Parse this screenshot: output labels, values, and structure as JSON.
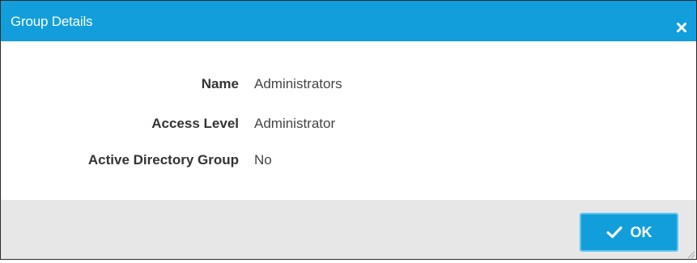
{
  "dialog": {
    "title": "Group Details",
    "close_icon": "close-icon"
  },
  "details": [
    {
      "label": "Name",
      "value": "Administrators"
    },
    {
      "label": "Access Level",
      "value": "Administrator"
    },
    {
      "label": "Active Directory Group",
      "value": "No"
    }
  ],
  "footer": {
    "ok_label": "OK",
    "ok_icon": "check-icon"
  },
  "colors": {
    "accent": "#119edb",
    "footer_bg": "#e7e7e7"
  }
}
